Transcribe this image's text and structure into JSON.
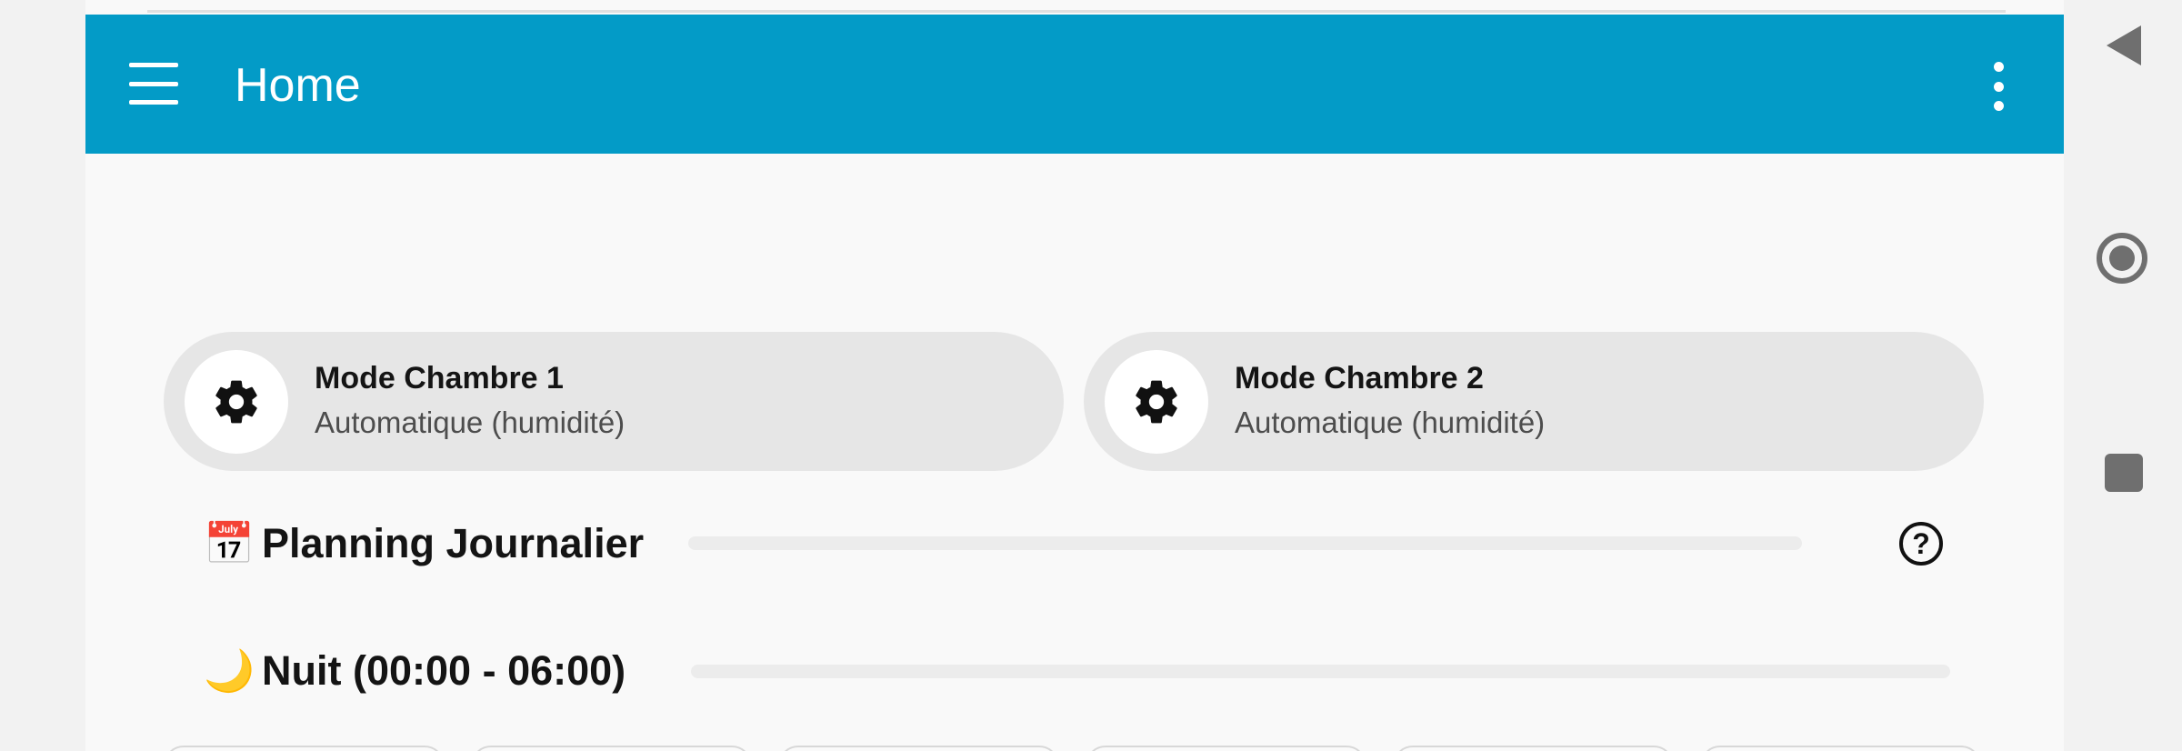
{
  "colors": {
    "accent": "#039bc7",
    "card_bg": "#e6e6e6",
    "nav_gray": "#6f6f6f"
  },
  "app_bar": {
    "title": "Home",
    "menu_icon": "hamburger-menu-icon",
    "overflow_icon": "more-vertical-icon"
  },
  "cards": [
    {
      "name": "Mode Chambre 1",
      "state": "Automatique (humidité)",
      "icon": "gear-icon"
    },
    {
      "name": "Mode Chambre 2",
      "state": "Automatique (humidité)",
      "icon": "gear-icon"
    }
  ],
  "sections": {
    "planning": {
      "emoji": "📅",
      "title": "Planning Journalier",
      "help_icon": "help-circle-icon",
      "help_glyph": "?"
    },
    "night": {
      "emoji": "🌙",
      "title": "Nuit (00:00 - 06:00)"
    }
  },
  "system_nav": {
    "back_icon": "back-triangle-icon",
    "home_icon": "home-circle-icon",
    "recents_icon": "recents-square-icon"
  }
}
